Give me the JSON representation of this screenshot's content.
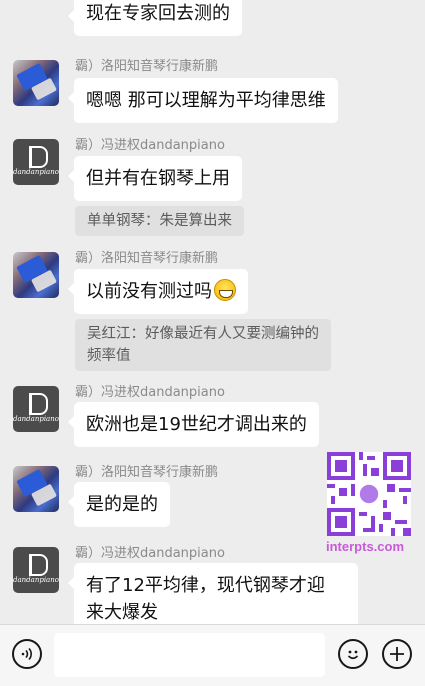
{
  "messages": [
    {
      "text": "现在专家回去测的"
    },
    {
      "sender": "霸）洛阳知音琴行康新鹏",
      "text": "嗯嗯 那可以理解为平均律思维"
    },
    {
      "sender": "霸）冯进权dandanpiano",
      "text": "但并有在钢琴上用",
      "quote": "单单钢琴：朱是算出来"
    },
    {
      "sender": "霸）洛阳知音琴行康新鹏",
      "text": "以前没有测过吗",
      "quote_line1": "吴红江：好像最近有人又要测编钟的",
      "quote_line2": "频率值"
    },
    {
      "sender": "霸）冯进权dandanpiano",
      "text": "欧洲也是19世纪才调出来的"
    },
    {
      "sender": "霸）洛阳知音琴行康新鹏",
      "text": "是的是的"
    },
    {
      "sender": "霸）冯进权dandanpiano",
      "line1": "有了12平均律，现代钢琴才迎",
      "line2": "来大爆发"
    }
  ],
  "avatar_text": "dandanpiano",
  "watermark": "interpts.com",
  "icons": {
    "voice": "voice-icon",
    "emoji": "emoji-icon",
    "plus": "plus-icon",
    "grin": "grinning-emoji-icon",
    "qr": "qr-code"
  }
}
